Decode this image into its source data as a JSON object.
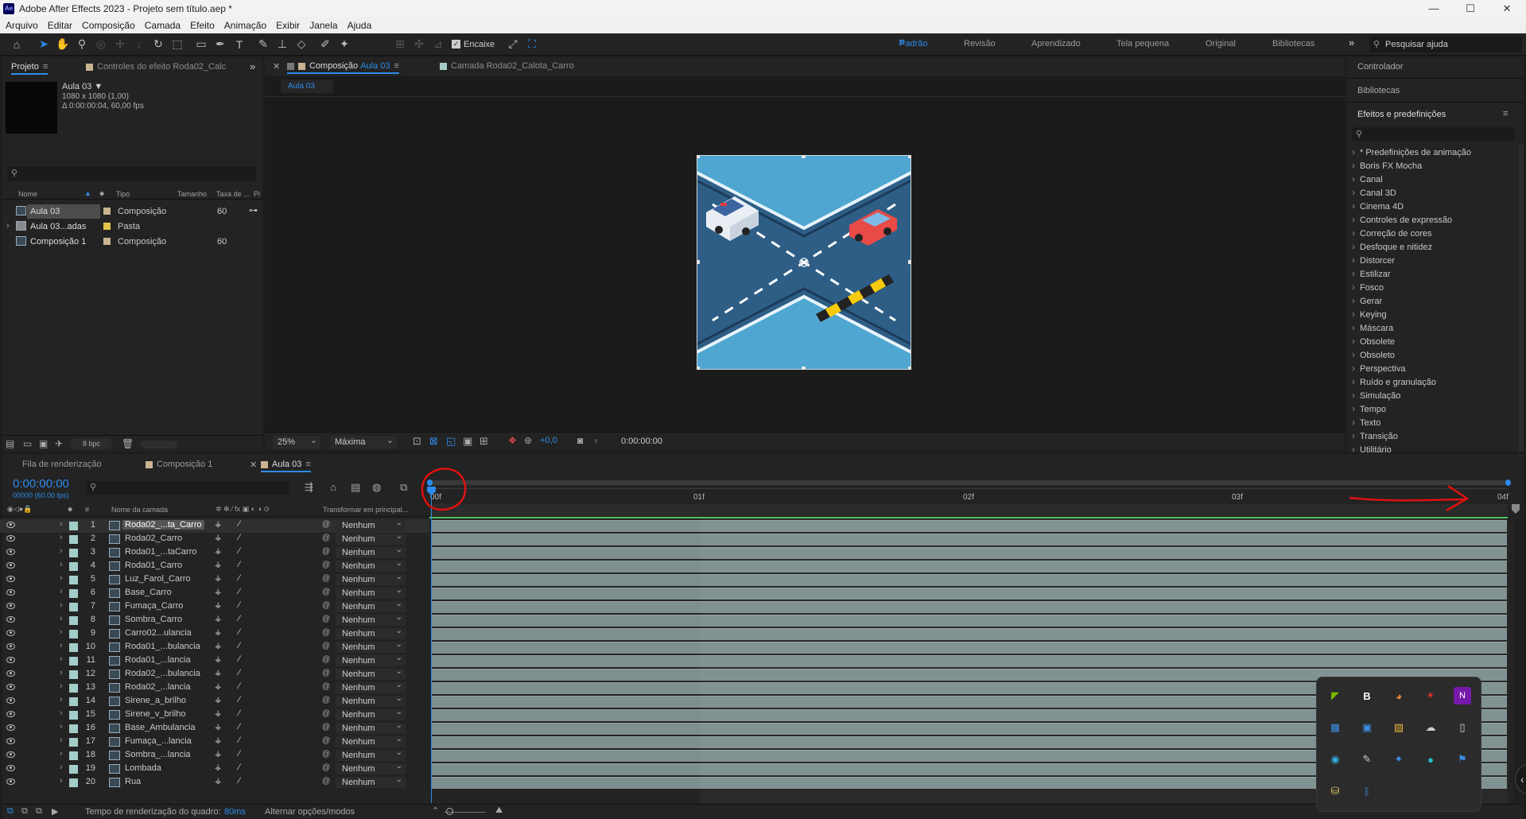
{
  "window": {
    "title": "Adobe After Effects 2023 - Projeto sem título.aep *",
    "app_icon": "Ae",
    "minimize": "—",
    "maximize": "☐",
    "close": "✕"
  },
  "menu": [
    "Arquivo",
    "Editar",
    "Composição",
    "Camada",
    "Efeito",
    "Animação",
    "Exibir",
    "Janela",
    "Ajuda"
  ],
  "toolbar": {
    "snap_label": "Encaixe",
    "workspaces": [
      "Padrão",
      "Revisão",
      "Aprendizado",
      "Tela pequena",
      "Original",
      "Bibliotecas"
    ],
    "active_workspace": "Padrão",
    "more": "»",
    "help_placeholder": "Pesquisar ajuda"
  },
  "project_panel": {
    "tabs": {
      "project": "Projeto",
      "effect_controls": "Controles do efeito Roda02_Calc"
    },
    "more": "»",
    "selected_item": {
      "name": "Aula 03 ▼",
      "size": "1080 x 1080 (1,00)",
      "duration": "Δ 0:00:00:04, 60,00 fps"
    },
    "search_placeholder": "",
    "columns": [
      "Nome",
      "Tipo",
      "Tamanho",
      "Taxa de ...",
      "Pi"
    ],
    "items": [
      {
        "name": "Aula 03",
        "type": "Composição",
        "rate": "60",
        "color": "#c9b48f"
      },
      {
        "name": "Aula 03...adas",
        "type": "Pasta",
        "rate": "",
        "color": "#e3c54a"
      },
      {
        "name": "Composição 1",
        "type": "Composição",
        "rate": "60",
        "color": "#c9b48f"
      }
    ],
    "bpc": "8 bpc"
  },
  "comp_panel": {
    "tab_prefix": "Composição",
    "tab_comp": "Aula 03",
    "layer_tab": "Camada Roda02_Calota_Carro",
    "breadcrumb": "Aula 03",
    "zoom": "25%",
    "quality": "Máxima",
    "exposure": "+0,0",
    "timecode": "0:00:00:00"
  },
  "right_panel": {
    "controller": "Controlador",
    "libraries": "Bibliotecas",
    "effects_title": "Efeitos e predefinições",
    "effects": [
      "* Predefinições de animação",
      "Boris FX Mocha",
      "Canal",
      "Canal 3D",
      "Cinema 4D",
      "Controles de expressão",
      "Correção de cores",
      "Desfoque e nitidez",
      "Distorcer",
      "Estilizar",
      "Fosco",
      "Gerar",
      "Keying",
      "Máscara",
      "Obsolete",
      "Obsoleto",
      "Perspectiva",
      "Ruído e granulação",
      "Simulação",
      "Tempo",
      "Texto",
      "Transição",
      "Utilitário"
    ]
  },
  "timeline": {
    "tabs": [
      "Fila de renderização",
      "Composição 1",
      "Aula 03"
    ],
    "active_tab": "Aula 03",
    "timecode": "0:00:00:00",
    "frame_info": "00000 (60.00 fps)",
    "header_name": "Nome da camada",
    "header_parent": "Transformar em principal...",
    "header_num": "#",
    "ruler": [
      "00f",
      "01f",
      "02f",
      "03f",
      "04f"
    ],
    "layers": [
      {
        "n": "1",
        "name": "Roda02_...ta_Carro"
      },
      {
        "n": "2",
        "name": "Roda02_Carro"
      },
      {
        "n": "3",
        "name": "Roda01_...taCarro"
      },
      {
        "n": "4",
        "name": "Roda01_Carro"
      },
      {
        "n": "5",
        "name": "Luz_Farol_Carro"
      },
      {
        "n": "6",
        "name": "Base_Carro"
      },
      {
        "n": "7",
        "name": "Fumaça_Carro"
      },
      {
        "n": "8",
        "name": "Sombra_Carro"
      },
      {
        "n": "9",
        "name": "Carro02...ulancia"
      },
      {
        "n": "10",
        "name": "Roda01_...bulancia"
      },
      {
        "n": "11",
        "name": "Roda01_...lancia"
      },
      {
        "n": "12",
        "name": "Roda02_...bulancia"
      },
      {
        "n": "13",
        "name": "Roda02_...lancia"
      },
      {
        "n": "14",
        "name": "Sirene_a_brilho"
      },
      {
        "n": "15",
        "name": "Sirene_v_brilho"
      },
      {
        "n": "16",
        "name": "Base_Ambulancia"
      },
      {
        "n": "17",
        "name": "Fumaça_...lancia"
      },
      {
        "n": "18",
        "name": "Sombra_...lancia"
      },
      {
        "n": "19",
        "name": "Lombada"
      },
      {
        "n": "20",
        "name": "Rua"
      }
    ],
    "parent_value": "Nenhum"
  },
  "status": {
    "render_label": "Tempo de renderização do quadro:",
    "render_value": "80ms",
    "toggle": "Alternar opções/modos"
  }
}
